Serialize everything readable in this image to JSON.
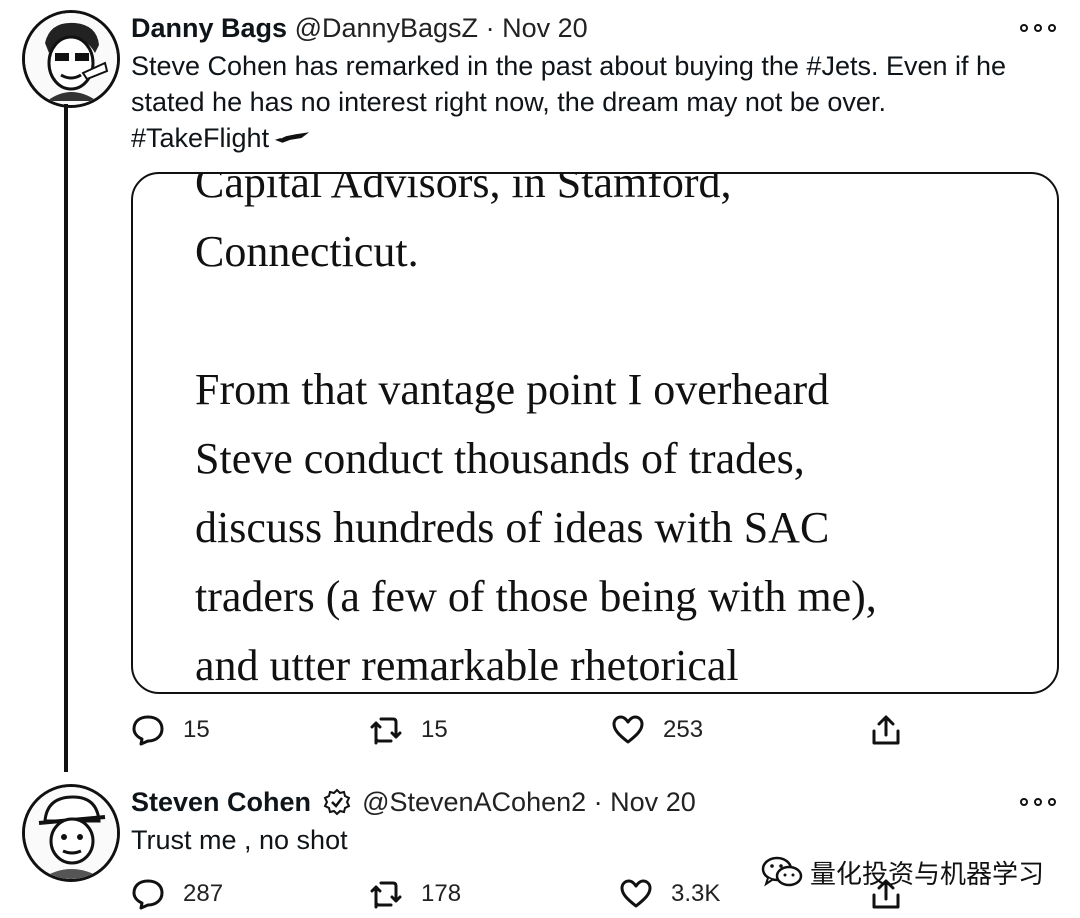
{
  "tweets": [
    {
      "name": "Danny Bags",
      "handle": "@DannyBagsZ",
      "separator": "·",
      "date": "Nov 20",
      "text_lines": [
        "Steve Cohen has remarked in the past about buying the #Jets. Even if he",
        "stated he has no interest right now, the dream may not be over.",
        "#TakeFlight"
      ],
      "emoji": "jet-logo",
      "card_lines": [
        "Capital Advisors, in Stamford,",
        "Connecticut.",
        "",
        "From that vantage point I overheard",
        "Steve conduct thousands of trades,",
        "discuss hundreds of ideas with SAC",
        "traders (a few of those being with me),",
        "and utter remarkable rhetorical"
      ],
      "replies": "15",
      "retweets": "15",
      "likes": "253"
    },
    {
      "name": "Steven Cohen",
      "verified": true,
      "handle": "@StevenACohen2",
      "separator": "·",
      "date": "Nov 20",
      "text": "Trust me , no shot",
      "replies": "287",
      "retweets": "178",
      "likes": "3.3K"
    }
  ],
  "watermark": "量化投资与机器学习",
  "icons": {
    "reply": "speech-bubble-icon",
    "retweet": "retweet-icon",
    "like": "heart-icon",
    "share": "share-icon",
    "more": "more-options-icon"
  }
}
